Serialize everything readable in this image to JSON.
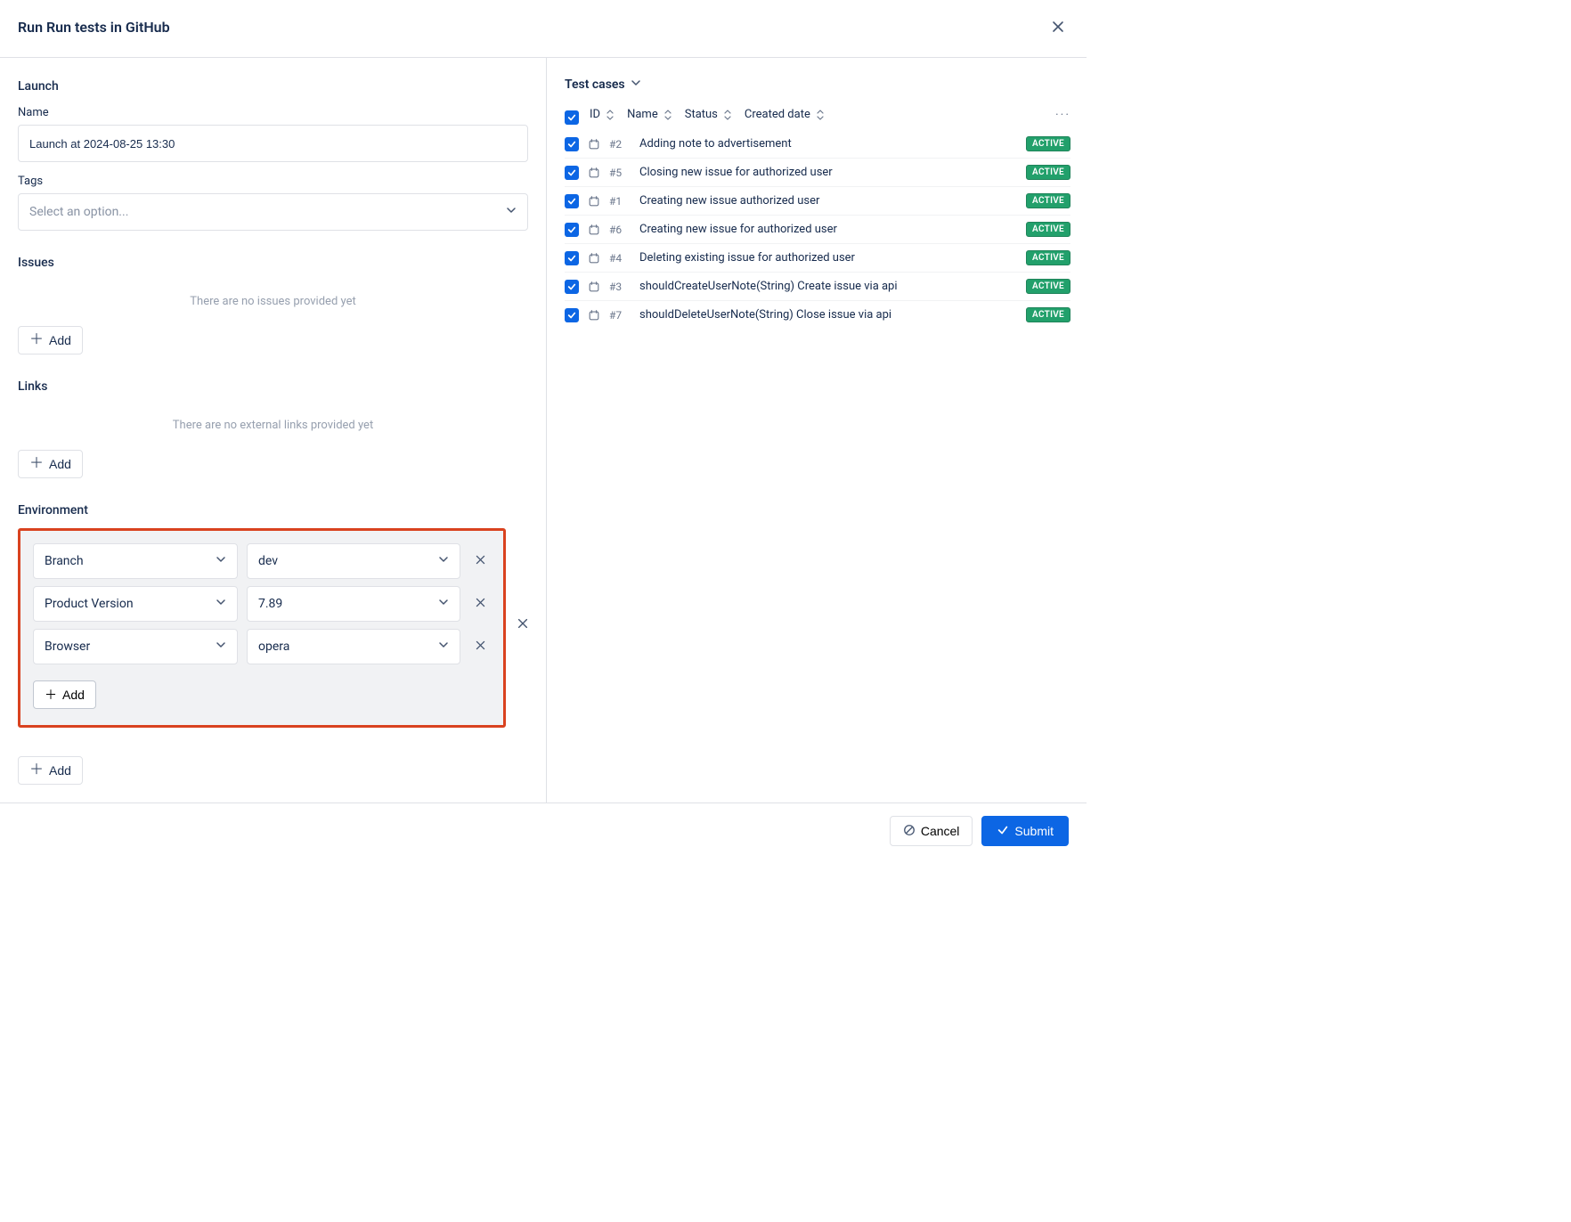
{
  "header": {
    "title": "Run Run tests in GitHub"
  },
  "launch": {
    "section_label": "Launch",
    "name_label": "Name",
    "name_value": "Launch at 2024-08-25 13:30",
    "tags_label": "Tags",
    "tags_placeholder": "Select an option...",
    "issues_label": "Issues",
    "issues_empty": "There are no issues provided yet",
    "add_label": "Add",
    "links_label": "Links",
    "links_empty": "There are no external links provided yet",
    "env_label": "Environment",
    "env_rows": [
      {
        "key": "Branch",
        "value": "dev"
      },
      {
        "key": "Product Version",
        "value": "7.89"
      },
      {
        "key": "Browser",
        "value": "opera"
      }
    ]
  },
  "test_cases": {
    "header": "Test cases",
    "columns": {
      "id": "ID",
      "name": "Name",
      "status": "Status",
      "created": "Created date"
    },
    "rows": [
      {
        "id": "#2",
        "name": "Adding note to advertisement",
        "status": "ACTIVE"
      },
      {
        "id": "#5",
        "name": "Closing new issue for authorized user",
        "status": "ACTIVE"
      },
      {
        "id": "#1",
        "name": "Creating new issue authorized user",
        "status": "ACTIVE"
      },
      {
        "id": "#6",
        "name": "Creating new issue for authorized user",
        "status": "ACTIVE"
      },
      {
        "id": "#4",
        "name": "Deleting existing issue for authorized user",
        "status": "ACTIVE"
      },
      {
        "id": "#3",
        "name": "shouldCreateUserNote(String) Create issue via api",
        "status": "ACTIVE"
      },
      {
        "id": "#7",
        "name": "shouldDeleteUserNote(String) Close issue via api",
        "status": "ACTIVE"
      }
    ]
  },
  "footer": {
    "cancel": "Cancel",
    "submit": "Submit"
  }
}
